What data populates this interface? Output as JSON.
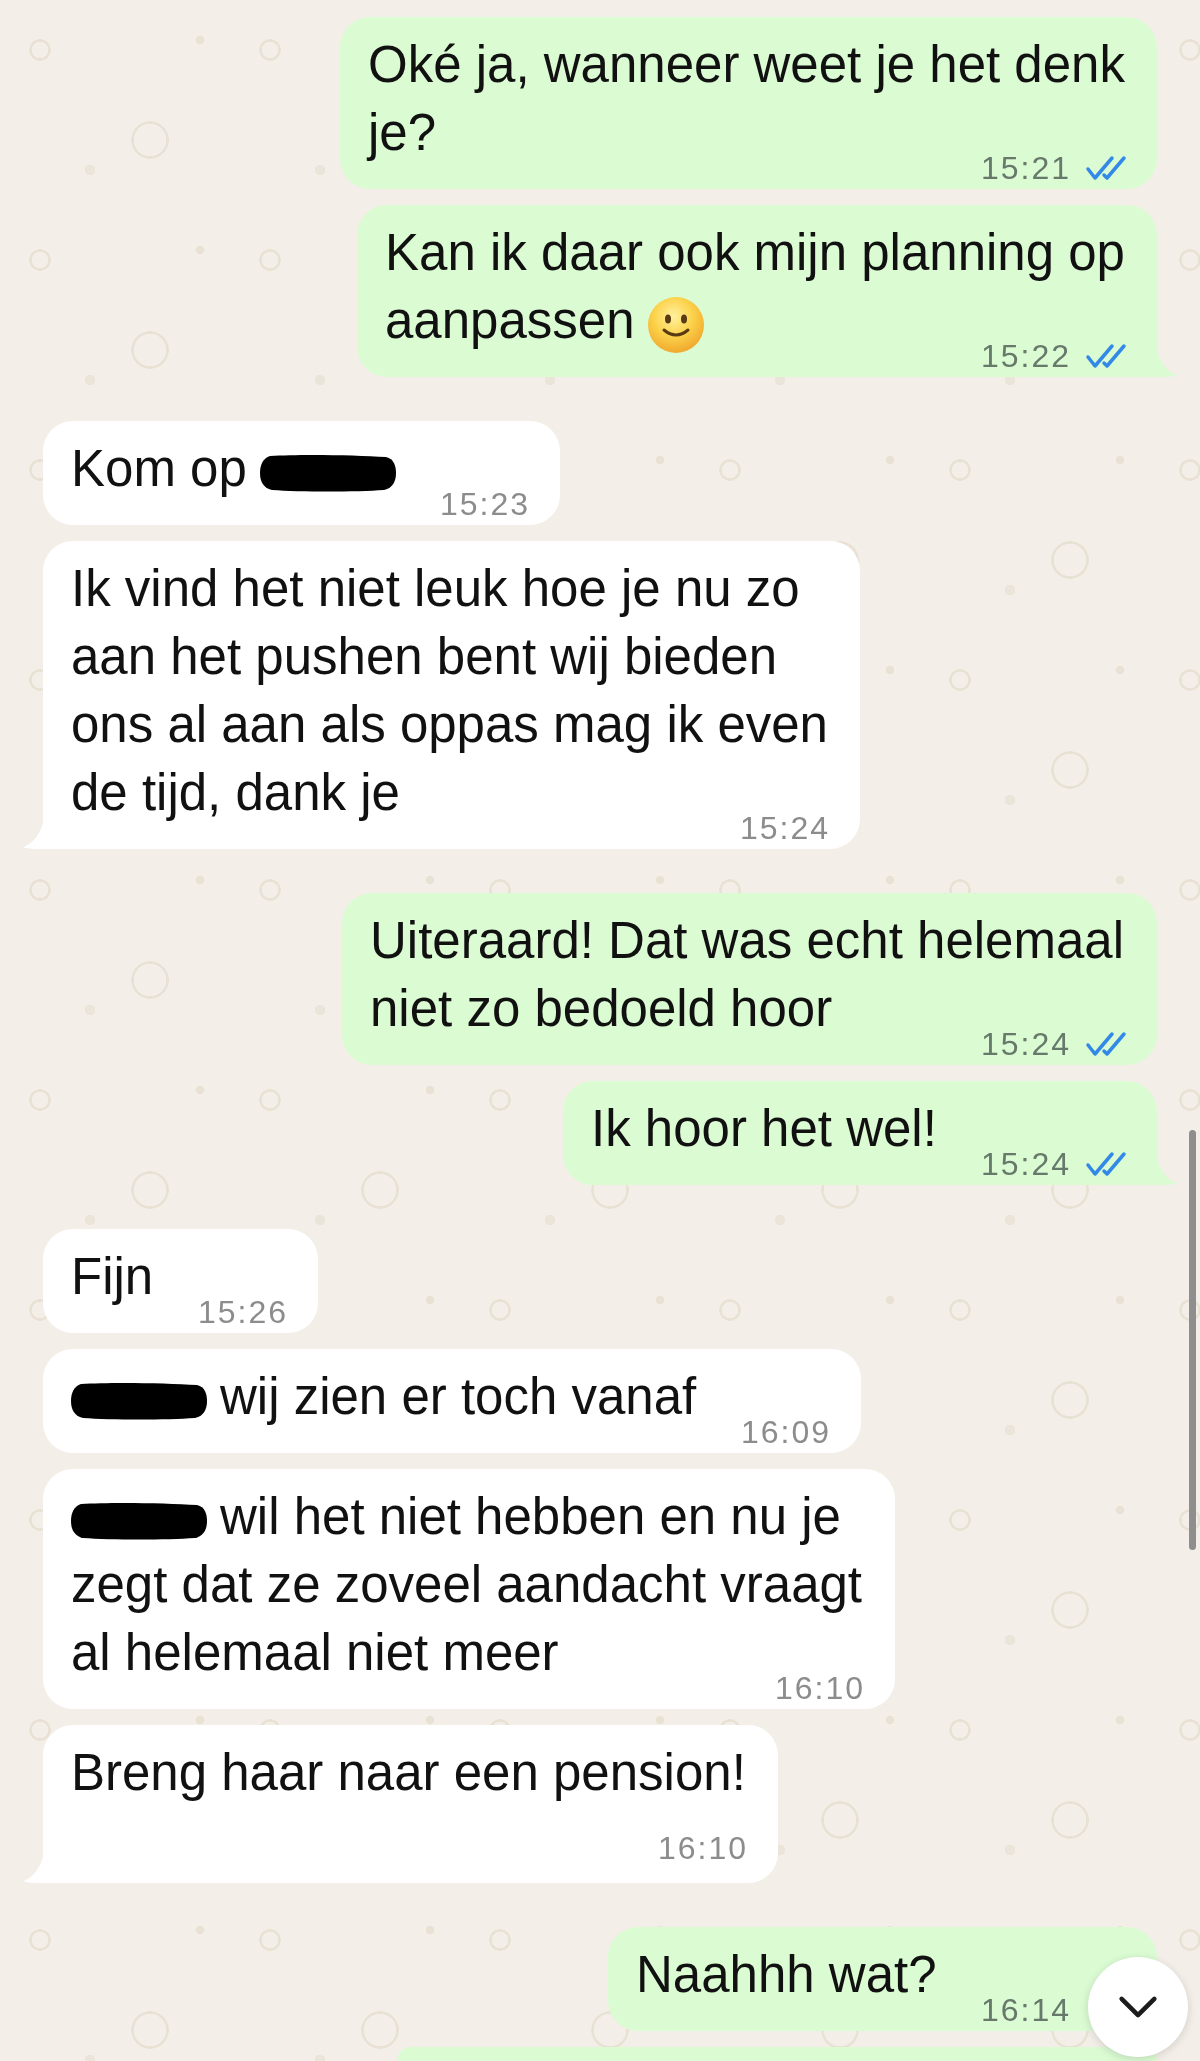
{
  "messages": [
    {
      "outgoing": true,
      "tail": false,
      "parts": [
        {
          "kind": "text",
          "text": "Oké ja, wanneer weet je het denk je?"
        }
      ],
      "time": "15:21",
      "read": true
    },
    {
      "outgoing": true,
      "tail": true,
      "parts": [
        {
          "kind": "text",
          "text": "Kan ik daar ook mijn planning op aanpassen"
        },
        {
          "kind": "emoji"
        }
      ],
      "time": "15:22",
      "read": true
    },
    {
      "outgoing": false,
      "tail": false,
      "parts": [
        {
          "kind": "text",
          "text": "Kom op"
        },
        {
          "kind": "redaction"
        }
      ],
      "time": "15:23"
    },
    {
      "outgoing": false,
      "tail": true,
      "parts": [
        {
          "kind": "text",
          "text": "Ik vind het niet leuk hoe je nu zo aan het pushen bent wij bieden ons al aan als oppas mag ik even de tijd, dank je"
        }
      ],
      "time": "15:24"
    },
    {
      "outgoing": true,
      "tail": false,
      "parts": [
        {
          "kind": "text",
          "text": "Uiteraard! Dat was echt helemaal niet zo bedoeld hoor"
        }
      ],
      "time": "15:24",
      "read": true
    },
    {
      "outgoing": true,
      "tail": true,
      "parts": [
        {
          "kind": "text",
          "text": "Ik hoor het wel!"
        }
      ],
      "time": "15:24",
      "read": true
    },
    {
      "outgoing": false,
      "tail": false,
      "parts": [
        {
          "kind": "text",
          "text": "Fijn"
        }
      ],
      "time": "15:26"
    },
    {
      "outgoing": false,
      "tail": false,
      "parts": [
        {
          "kind": "redaction"
        },
        {
          "kind": "text",
          "text": "wij zien er toch vanaf"
        }
      ],
      "time": "16:09"
    },
    {
      "outgoing": false,
      "tail": false,
      "parts": [
        {
          "kind": "redaction"
        },
        {
          "kind": "text",
          "text": "wil het niet hebben en nu je zegt dat ze zoveel aandacht vraagt al helemaal niet meer"
        }
      ],
      "time": "16:10"
    },
    {
      "outgoing": false,
      "tail": true,
      "parts": [
        {
          "kind": "text",
          "text": "Breng haar naar een pension!"
        }
      ],
      "time": "16:10"
    },
    {
      "outgoing": true,
      "tail": false,
      "parts": [
        {
          "kind": "text",
          "text": "Naahhh wat?"
        }
      ],
      "time": "16:14"
    },
    {
      "outgoing": true
    }
  ]
}
